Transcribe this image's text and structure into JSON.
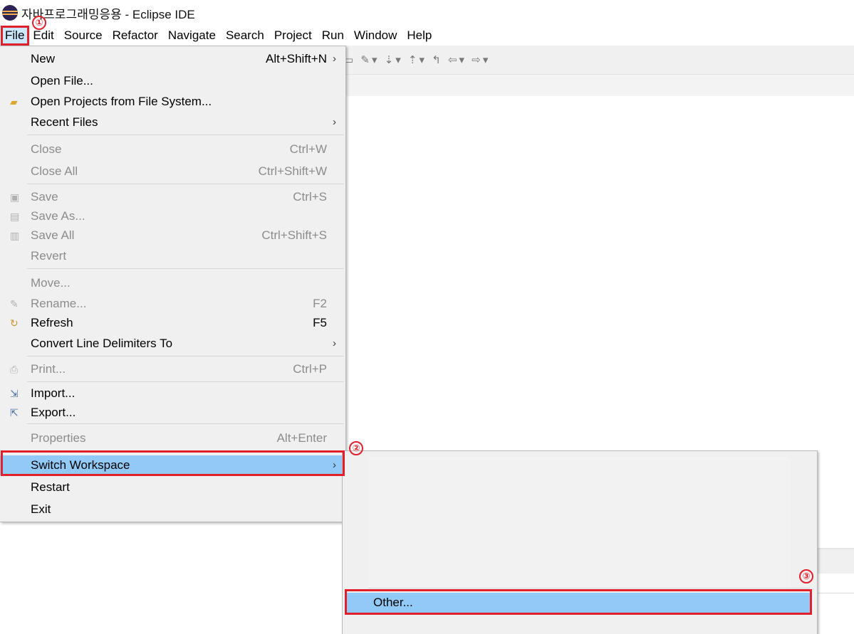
{
  "window": {
    "title": "자바프로그래밍응용 - Eclipse IDE"
  },
  "menubar": [
    "File",
    "Edit",
    "Source",
    "Refactor",
    "Navigate",
    "Search",
    "Project",
    "Run",
    "Window",
    "Help"
  ],
  "file_menu": {
    "new": {
      "label": "New",
      "shortcut": "Alt+Shift+N"
    },
    "open_file": {
      "label": "Open File..."
    },
    "open_projects": {
      "label": "Open Projects from File System..."
    },
    "recent_files": {
      "label": "Recent Files"
    },
    "close": {
      "label": "Close",
      "shortcut": "Ctrl+W"
    },
    "close_all": {
      "label": "Close All",
      "shortcut": "Ctrl+Shift+W"
    },
    "save": {
      "label": "Save",
      "shortcut": "Ctrl+S"
    },
    "save_as": {
      "label": "Save As..."
    },
    "save_all": {
      "label": "Save All",
      "shortcut": "Ctrl+Shift+S"
    },
    "revert": {
      "label": "Revert"
    },
    "move": {
      "label": "Move..."
    },
    "rename": {
      "label": "Rename...",
      "shortcut": "F2"
    },
    "refresh": {
      "label": "Refresh",
      "shortcut": "F5"
    },
    "convert": {
      "label": "Convert Line Delimiters To"
    },
    "print": {
      "label": "Print...",
      "shortcut": "Ctrl+P"
    },
    "import": {
      "label": "Import..."
    },
    "export": {
      "label": "Export..."
    },
    "properties": {
      "label": "Properties",
      "shortcut": "Alt+Enter"
    },
    "switch_workspace": {
      "label": "Switch Workspace"
    },
    "restart": {
      "label": "Restart"
    },
    "exit": {
      "label": "Exit"
    }
  },
  "submenu": {
    "other": {
      "label": "Other..."
    }
  },
  "annotations": {
    "step1": "①",
    "step2": "②",
    "step3": "③",
    "color": "#e0202a"
  },
  "highlight_color": "#91c9f7"
}
